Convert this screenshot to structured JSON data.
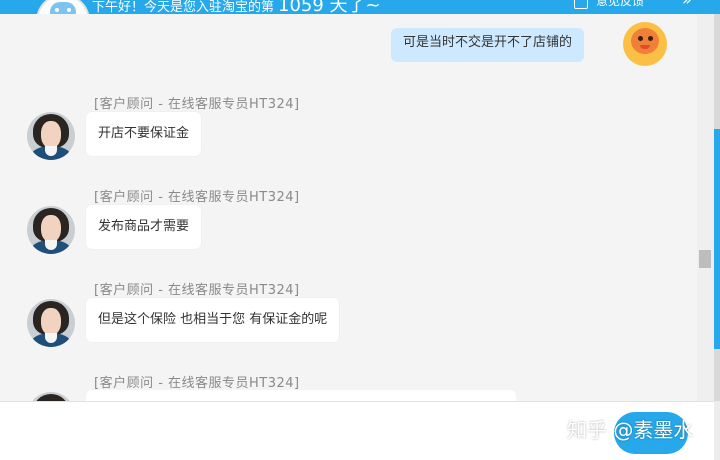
{
  "header": {
    "greeting": "下午好！今天是您入驻淘宝的第",
    "days": "1059 天了~",
    "feedback_label": "意见反馈",
    "collapse_glyph": "»"
  },
  "messages": [
    {
      "from": "user",
      "text": "可是当时不交是开不了店铺的"
    },
    {
      "from": "agent",
      "sender": "[客户顾问 - 在线客服专员HT324]",
      "text": "开店不要保证金"
    },
    {
      "from": "agent",
      "sender": "[客户顾问 - 在线客服专员HT324]",
      "text": "发布商品才需要"
    },
    {
      "from": "agent",
      "sender": "[客户顾问 - 在线客服专员HT324]",
      "text": "但是这个保险 也相当于您 有保证金的呢"
    },
    {
      "from": "agent",
      "sender": "[客户顾问 - 在线客服专员HT324]",
      "text": ""
    }
  ],
  "watermark": "知乎 @素墨水",
  "colors": {
    "accent": "#26a8ea",
    "user_bubble": "#cde9ff",
    "agent_bubble": "#ffffff"
  },
  "icons": {
    "feedback": "edit-icon",
    "collapse": "double-chevron-right-icon"
  }
}
